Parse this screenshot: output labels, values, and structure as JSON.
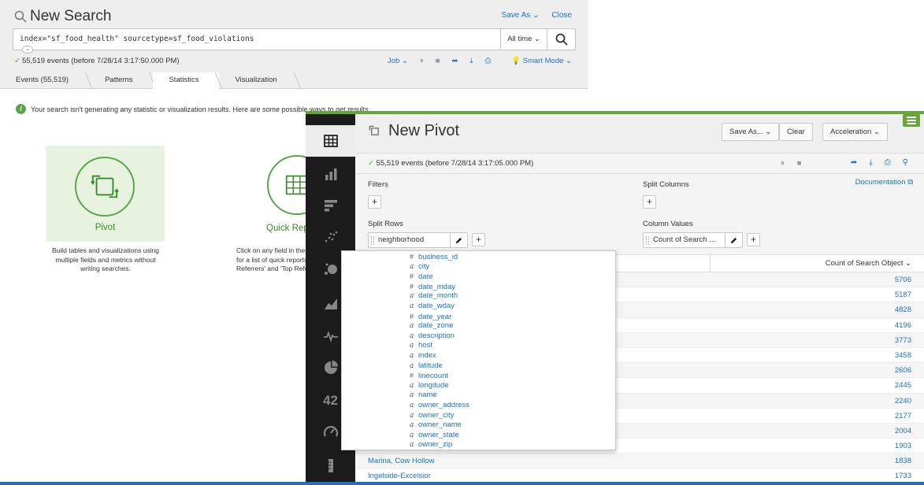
{
  "search": {
    "title": "New Search",
    "save_as": "Save As",
    "close": "Close",
    "query": "index=\"sf_food_health\" sourcetype=sf_food_violations",
    "time_range": "All time",
    "events_summary": "55,519 events (before 7/28/14 3:17:50.000 PM)",
    "job": "Job",
    "smart_mode": "Smart Mode",
    "tabs": [
      "Events (55,519)",
      "Patterns",
      "Statistics",
      "Visualization"
    ],
    "info_message": "Your search isn't generating any statistic or visualization results. Here are some possible ways to get results.",
    "pivot_label": "Pivot",
    "pivot_desc": [
      "Build tables and visualizations using",
      "multiple fields and metrics without",
      "writing searches."
    ],
    "quick_label": "Quick Reports",
    "quick_desc": [
      "Click on any field in the events tab",
      "for a list of quick reports like 'Top",
      "Referrers' and 'Top Referrer Domains'."
    ]
  },
  "pivot": {
    "title": "New Pivot",
    "save_as": "Save As...",
    "clear": "Clear",
    "acceleration": "Acceleration",
    "events_summary": "55,519 events (before 7/28/14 3:17:05.000 PM)",
    "documentation": "Documentation",
    "filters_label": "Filters",
    "split_columns_label": "Split Columns",
    "split_rows_label": "Split Rows",
    "column_values_label": "Column Values",
    "split_row_field": "neighborhood",
    "column_value_field": "Count of Search ...",
    "table_header": "Count of Search Object",
    "sidebar_number": "42",
    "rows": [
      {
        "name": "",
        "value": "5706"
      },
      {
        "name": "",
        "value": "5187"
      },
      {
        "name": "",
        "value": "4828"
      },
      {
        "name": "",
        "value": "4196"
      },
      {
        "name": "",
        "value": "3773"
      },
      {
        "name": "",
        "value": "3458"
      },
      {
        "name": "",
        "value": "2606"
      },
      {
        "name": "",
        "value": "2445"
      },
      {
        "name": "",
        "value": "2240"
      },
      {
        "name": "",
        "value": "2177"
      },
      {
        "name": "",
        "value": "2004"
      },
      {
        "name": "",
        "value": "1903"
      },
      {
        "name": "Marina, Cow Hollow",
        "value": "1838"
      },
      {
        "name": "Ingelside-Excelsior",
        "value": "1733"
      }
    ]
  },
  "dropdown": {
    "fields": [
      {
        "type": "#",
        "name": "business_id"
      },
      {
        "type": "a",
        "name": "city"
      },
      {
        "type": "#",
        "name": "date"
      },
      {
        "type": "#",
        "name": "date_mday"
      },
      {
        "type": "a",
        "name": "date_month"
      },
      {
        "type": "a",
        "name": "date_wday"
      },
      {
        "type": "#",
        "name": "date_year"
      },
      {
        "type": "a",
        "name": "date_zone"
      },
      {
        "type": "a",
        "name": "description"
      },
      {
        "type": "a",
        "name": "host"
      },
      {
        "type": "a",
        "name": "index"
      },
      {
        "type": "a",
        "name": "latitude"
      },
      {
        "type": "#",
        "name": "linecount"
      },
      {
        "type": "a",
        "name": "longitude"
      },
      {
        "type": "a",
        "name": "name"
      },
      {
        "type": "a",
        "name": "owner_address"
      },
      {
        "type": "a",
        "name": "owner_city"
      },
      {
        "type": "a",
        "name": "owner_name"
      },
      {
        "type": "a",
        "name": "owner_state"
      },
      {
        "type": "a",
        "name": "owner_zip"
      }
    ]
  },
  "colors": {
    "accent_green": "#65a637",
    "link_blue": "#1a73c5",
    "sidebar_dark": "#1c1c1c"
  }
}
